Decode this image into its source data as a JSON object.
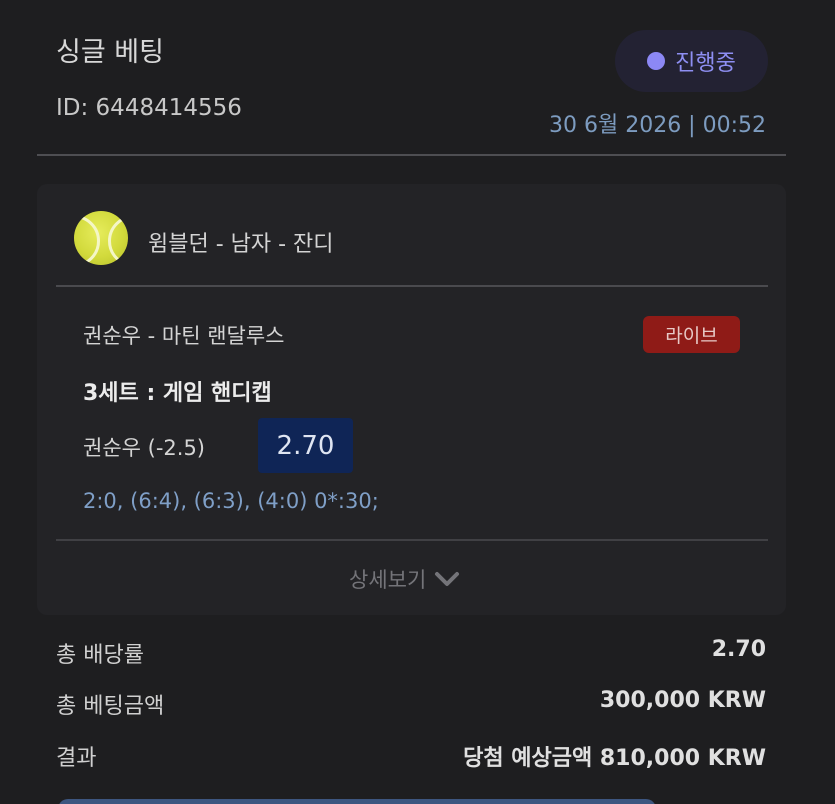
{
  "header": {
    "title": "싱글 베팅",
    "bet_id": "ID: 6448414556",
    "status": "진행중",
    "datetime": "30 6월 2026 | 00:52"
  },
  "colors": {
    "status_dot": "#8c88f5",
    "live_badge": "#8f1b17",
    "odds_box": "#0f2556",
    "score_text": "#7f9fc7"
  },
  "event": {
    "sport_icon": "tennis-ball-icon",
    "league": "윔블던 - 남자 - 잔디",
    "match": "권순우 - 마틴 랜달루스",
    "live_label": "라이브",
    "market": "3세트 : 게임 핸디캡",
    "selection": "권순우 (-2.5)",
    "odds": "2.70",
    "score": "2:0, (6:4), (6:3), (4:0) 0*:30;",
    "details_label": "상세보기",
    "details_icon": "chevron-down-icon"
  },
  "summary": {
    "total_odds_label": "총 배당률",
    "total_odds_value": "2.70",
    "total_stake_label": "총 베팅금액",
    "total_stake_value": "300,000 KRW",
    "result_label": "결과",
    "result_value": "당첨 예상금액 810,000 KRW"
  }
}
